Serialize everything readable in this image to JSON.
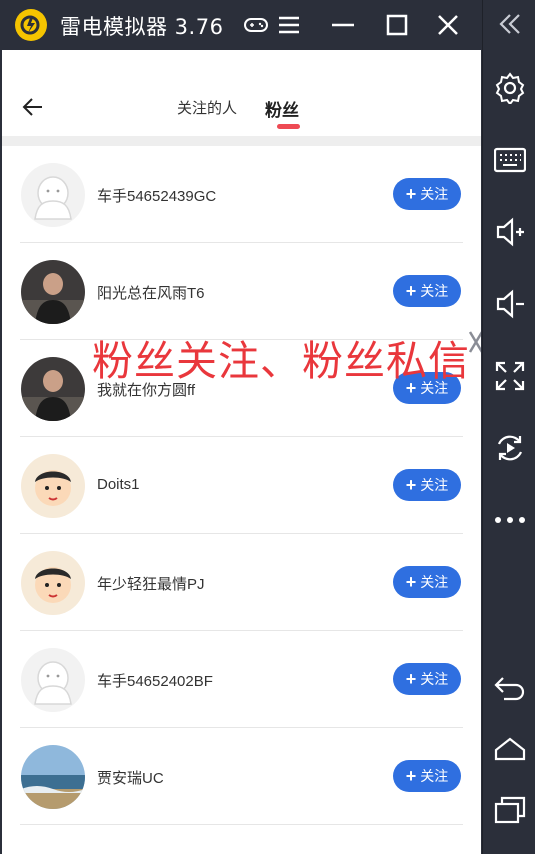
{
  "window": {
    "title": "雷电模拟器 3.76",
    "icons": [
      "gamepad-icon",
      "menu-icon",
      "minimize-icon",
      "maximize-icon",
      "close-icon",
      "collapse-icon"
    ]
  },
  "sidebar": {
    "items": [
      "gear-icon",
      "keyboard-icon",
      "volume-up-icon",
      "volume-down-icon",
      "fullscreen-icon",
      "sync-icon",
      "more-icon",
      "back-icon",
      "home-icon",
      "recent-apps-icon"
    ]
  },
  "header": {
    "tabs": [
      {
        "label": "关注的人",
        "active": false
      },
      {
        "label": "粉丝",
        "active": true
      }
    ]
  },
  "overlay_text": "粉丝关注、粉丝私信",
  "colors": {
    "accent_blue": "#2f6fe0",
    "tab_underline": "#ee4a54",
    "overlay_red": "#e9373c",
    "chrome": "#2b2f3a"
  },
  "users": [
    {
      "name": "车手54652439GC",
      "button": "关注",
      "avatar": "default-avatar"
    },
    {
      "name": "阳光总在风雨T6",
      "button": "关注",
      "avatar": "photo-avatar"
    },
    {
      "name": "我就在你方圆ff",
      "button": "关注",
      "avatar": "photo-avatar"
    },
    {
      "name": "Doits1",
      "button": "关注",
      "avatar": "cartoon-avatar"
    },
    {
      "name": "年少轻狂最情PJ",
      "button": "关注",
      "avatar": "cartoon-avatar"
    },
    {
      "name": "车手54652402BF",
      "button": "关注",
      "avatar": "default-avatar"
    },
    {
      "name": "贾安瑞UC",
      "button": "关注",
      "avatar": "landscape-avatar"
    }
  ]
}
